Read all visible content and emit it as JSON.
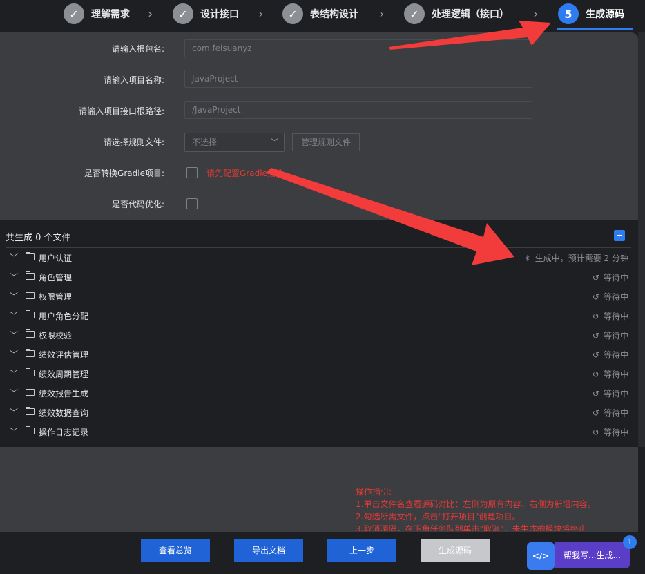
{
  "steps": [
    {
      "label": "理解需求",
      "mark": "✓"
    },
    {
      "label": "设计接口",
      "mark": "✓"
    },
    {
      "label": "表结构设计",
      "mark": "✓"
    },
    {
      "label": "处理逻辑（接口）",
      "mark": "✓"
    },
    {
      "label": "生成源码",
      "mark": "5"
    }
  ],
  "form": {
    "package_label": "请输入根包名:",
    "package_placeholder": "com.feisuanyz",
    "project_label": "请输入项目名称:",
    "project_placeholder": "JavaProject",
    "path_label": "请输入项目接口根路径:",
    "path_placeholder": "/JavaProject",
    "rule_label": "请选择规则文件:",
    "rule_select": "不选择",
    "manage_rules": "管理规则文件",
    "gradle_label": "是否转换Gradle项目:",
    "gradle_hint": "请先配置Gradle插件",
    "optimize_label": "是否代码优化:"
  },
  "files": {
    "summary": "共生成 0 个文件",
    "items": [
      {
        "name": "用户认证",
        "status": "生成中，预计需要 2 分钟",
        "icon": "loading"
      },
      {
        "name": "角色管理",
        "status": "等待中",
        "icon": "history"
      },
      {
        "name": "权限管理",
        "status": "等待中",
        "icon": "history"
      },
      {
        "name": "用户角色分配",
        "status": "等待中",
        "icon": "history"
      },
      {
        "name": "权限校验",
        "status": "等待中",
        "icon": "history"
      },
      {
        "name": "绩效评估管理",
        "status": "等待中",
        "icon": "history"
      },
      {
        "name": "绩效周期管理",
        "status": "等待中",
        "icon": "history"
      },
      {
        "name": "绩效报告生成",
        "status": "等待中",
        "icon": "history"
      },
      {
        "name": "绩效数据查询",
        "status": "等待中",
        "icon": "history"
      },
      {
        "name": "操作日志记录",
        "status": "等待中",
        "icon": "history"
      }
    ]
  },
  "guide": {
    "title": "操作指引:",
    "lines": [
      "1.单击文件名查看源码对比：左侧为原有内容，右侧为新增内容。",
      "2.勾选所需文件，点击\"打开项目\"创建项目。",
      "3.取消源码，在下角任务队列单击\"取消\"，未生成的模块将终止"
    ]
  },
  "footer": {
    "overview": "查看总览",
    "export": "导出文档",
    "prev": "上一步",
    "generate": "生成源码"
  },
  "helper": {
    "label": "帮我写...生成...",
    "badge": "1",
    "icon": "</>"
  }
}
